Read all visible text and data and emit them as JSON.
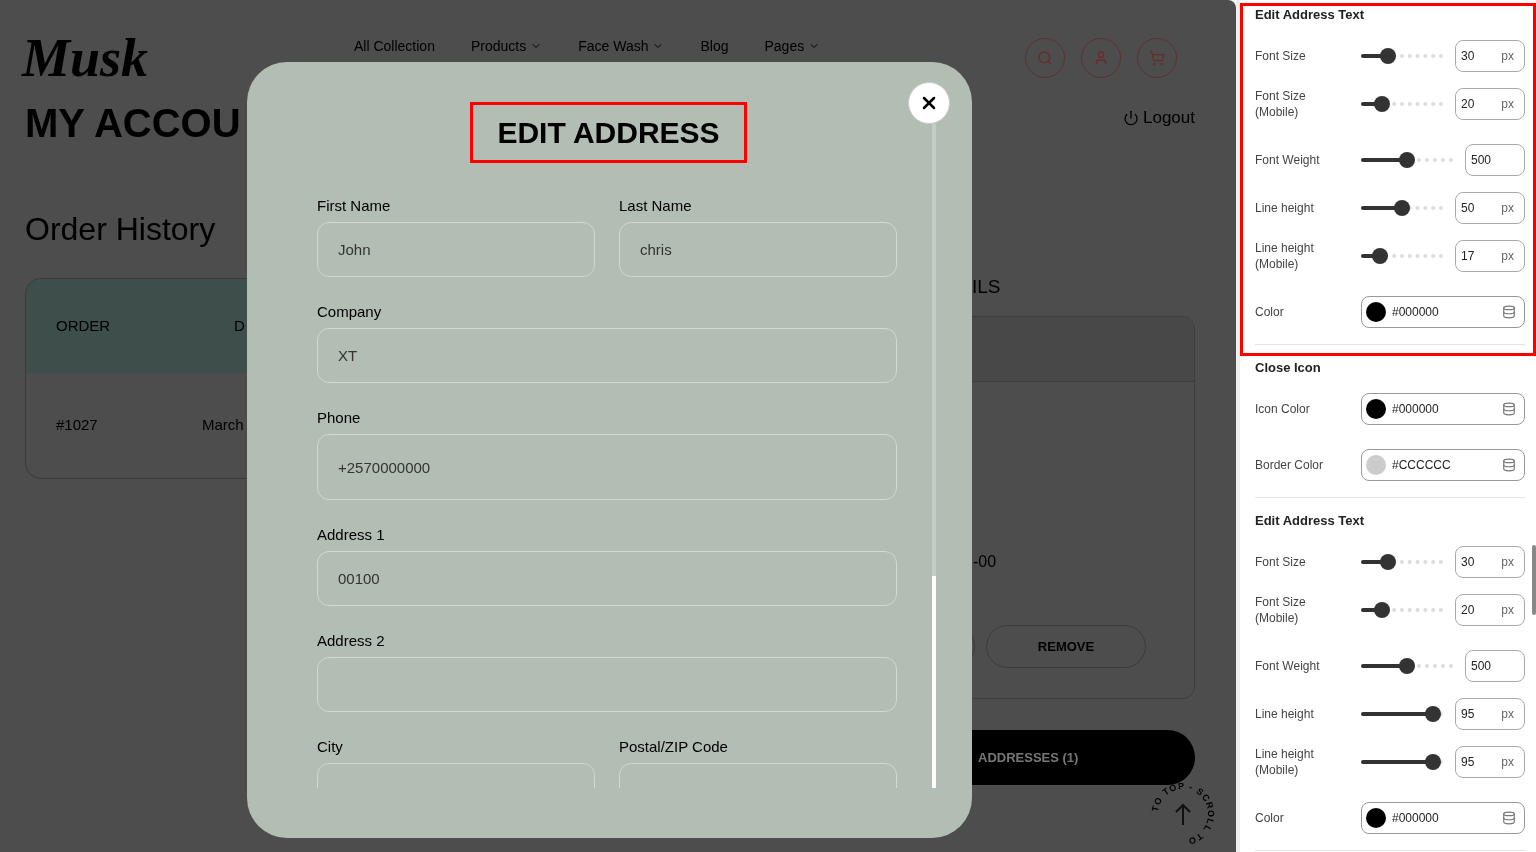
{
  "store": {
    "logo": "Musk",
    "nav": [
      {
        "label": "All Collection",
        "has_menu": false
      },
      {
        "label": "Products",
        "has_menu": true
      },
      {
        "label": "Face Wash",
        "has_menu": true
      },
      {
        "label": "Blog",
        "has_menu": false
      },
      {
        "label": "Pages",
        "has_menu": true
      }
    ],
    "page_title": "MY ACCOU",
    "logout": "Logout",
    "section_title": "Order History",
    "order_table": {
      "columns": [
        "ORDER",
        "D"
      ],
      "rows": [
        [
          "#1027",
          "March"
        ]
      ]
    },
    "address_heading": "ILS",
    "address_line": "-00",
    "remove_button": "REMOVE",
    "addresses_button": "ADDRESSES (1)",
    "scroll_to_top": "TO TOP - SCROLL TO"
  },
  "modal": {
    "title": "EDIT ADDRESS",
    "title_highlighted": true,
    "fields": [
      {
        "label": "First Name",
        "value": "John",
        "half": true
      },
      {
        "label": "Last Name",
        "value": "chris",
        "half": true
      },
      {
        "label": "Company",
        "value": "XT",
        "half": false
      },
      {
        "label": "Phone",
        "value": "+2570000000",
        "half": false
      },
      {
        "label": "Address 1",
        "value": "00100",
        "half": false
      },
      {
        "label": "Address 2",
        "half": false
      },
      {
        "label": "City",
        "half": true
      },
      {
        "label": "Postal/ZIP Code",
        "half": true
      }
    ]
  },
  "settings": {
    "sections": [
      {
        "title": "Edit Address Text",
        "highlighted": true,
        "rows": [
          {
            "kind": "slider",
            "label": "Font Size",
            "level": 0.33,
            "value": "30",
            "unit": "px"
          },
          {
            "kind": "slider",
            "label": "Font Size (Mobile)",
            "level": 0.25,
            "value": "20",
            "unit": "px"
          },
          {
            "kind": "slider",
            "label": "Font Weight",
            "level": 0.5,
            "value": "500"
          },
          {
            "kind": "slider",
            "label": "Line height",
            "level": 0.5,
            "value": "50",
            "unit": "px"
          },
          {
            "kind": "slider",
            "label": "Line height (Mobile)",
            "level": 0.23,
            "value": "17",
            "unit": "px"
          },
          {
            "kind": "color",
            "label": "Color",
            "color": "#000000",
            "value": "#000000"
          }
        ]
      },
      {
        "title": "Close Icon",
        "highlighted": false,
        "rows": [
          {
            "kind": "color",
            "label": "Icon Color",
            "color": "#000000",
            "value": "#000000"
          },
          {
            "kind": "color",
            "label": "Border Color",
            "color": "#cccccc",
            "value": "#CCCCCC"
          }
        ]
      },
      {
        "title": "Edit Address Text",
        "highlighted": false,
        "rows": [
          {
            "kind": "slider",
            "label": "Font Size",
            "level": 0.33,
            "value": "30",
            "unit": "px"
          },
          {
            "kind": "slider",
            "label": "Font Size (Mobile)",
            "level": 0.25,
            "value": "20",
            "unit": "px"
          },
          {
            "kind": "slider",
            "label": "Font Weight",
            "level": 0.5,
            "value": "500"
          },
          {
            "kind": "slider",
            "label": "Line height",
            "level": 0.88,
            "value": "95",
            "unit": "px"
          },
          {
            "kind": "slider",
            "label": "Line height (Mobile)",
            "level": 0.88,
            "value": "95",
            "unit": "px"
          },
          {
            "kind": "color",
            "label": "Color",
            "color": "#000000",
            "value": "#000000"
          }
        ]
      }
    ]
  }
}
